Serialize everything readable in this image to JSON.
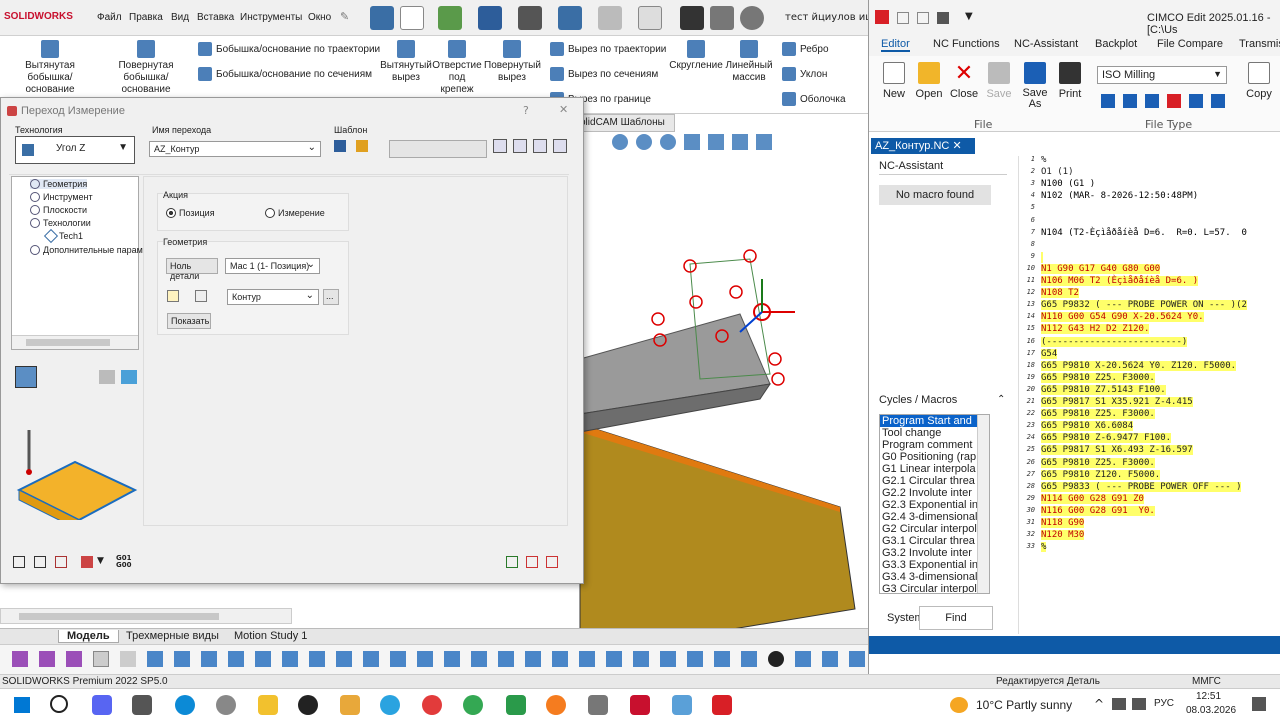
{
  "solidworks": {
    "logo": "SOLIDWORKS",
    "menu": [
      "Файл",
      "Правка",
      "Вид",
      "Вставка",
      "Инструменты",
      "Окно"
    ],
    "doc_title": "тест йциулов ищме",
    "ribbon": {
      "extruded_boss": "Вытянутая бобышка/основание",
      "revolved_boss": "Повернутая бобышка/основание",
      "swept_boss": "Бобышка/основание по траектории",
      "lofted_boss": "Бобышка/основание по сечениям",
      "extruded_cut": "Вытянутый вырез",
      "hole_wizard": "Отверстие под крепеж",
      "revolved_cut": "Повернутый вырез",
      "swept_cut": "Вырез по траектории",
      "lofted_cut": "Вырез по сечениям",
      "boundary_cut": "Вырез по границе",
      "fillet": "Скругление",
      "linear_pattern": "Линейный массив",
      "rib": "Ребро",
      "draft": "Уклон",
      "shell": "Оболочка"
    },
    "solidcam_tab": "olidCAM Шаблоны",
    "bottom_tabs": [
      "Модель",
      "Трехмерные виды",
      "Motion Study 1"
    ],
    "status_left": "SOLIDWORKS Premium 2022 SP5.0",
    "status_mid": "Редактируется Деталь",
    "status_right": "ММГС"
  },
  "dialog": {
    "title": "Переход Измерение",
    "tech_label": "Технология",
    "tech_value": "Угол Z",
    "name_label": "Имя перехода",
    "name_value": "AZ_Контур",
    "template_label": "Шаблон",
    "tree": [
      "Геометрия",
      "Инструмент",
      "Плоскости",
      "Технологии",
      "Tech1",
      "Дополнительные парам"
    ],
    "action_label": "Акция",
    "radio_position": "Позиция",
    "radio_measure": "Измерение",
    "geometry_label": "Геометрия",
    "part_zero_btn": "Ноль детали",
    "mac_value": "Мас 1 (1- Позиция)",
    "contour_value": "Контур",
    "ellipsis": "...",
    "show_btn": "Показать",
    "help": "?",
    "close": "✕"
  },
  "cimco": {
    "title": "CIMCO Edit 2025.01.16 - [C:\\Us",
    "tabs": [
      "Editor",
      "NC Functions",
      "NC-Assistant",
      "Backplot",
      "File Compare",
      "Transmis"
    ],
    "ribbon": {
      "new": "New",
      "open": "Open",
      "close": "Close",
      "save": "Save",
      "save_as": "Save As",
      "print": "Print",
      "copy": "Copy",
      "file_group": "File",
      "file_type_group": "File Type",
      "file_type_value": "ISO Milling"
    },
    "doc_tab": "AZ_Контур.NC",
    "nc_assistant": "NC-Assistant",
    "no_macro": "No macro found",
    "cycles_title": "Cycles / Macros",
    "cycles": [
      "Program Start and",
      "Tool change",
      "Program comment",
      "G0 Positioning (rap",
      "G1 Linear interpola",
      "G2.1 Circular threa",
      "G2.2 Involute inter",
      "G2.3 Exponential in",
      "G2.4 3-dimensional",
      "G2 Circular interpol",
      "G3.1 Circular threa",
      "G3.2 Involute inter",
      "G3.3 Exponential in",
      "G3.4 3-dimensional",
      "G3 Circular interpol"
    ],
    "system_label": "System",
    "find_btn": "Find",
    "code_lines": [
      {
        "n": "1",
        "t": "%",
        "style": "plain"
      },
      {
        "n": "2",
        "t": "O1 (1)",
        "style": "plain"
      },
      {
        "n": "3",
        "t": "N100 (G1 )",
        "style": "plain"
      },
      {
        "n": "4",
        "t": "N102 (MAR- 8-2026-12:50:48PM)",
        "style": "plain"
      },
      {
        "n": "5",
        "t": "",
        "style": "plain"
      },
      {
        "n": "6",
        "t": "",
        "style": "plain"
      },
      {
        "n": "7",
        "t": "N104 (T2-Èçìåðåíèå D=6.  R=0. L=57.  0",
        "style": "plain"
      },
      {
        "n": "8",
        "t": "",
        "style": "plain"
      },
      {
        "n": "9",
        "t": "",
        "style": "hl"
      },
      {
        "n": "10",
        "t": "N1 G90 G17 G40 G80 G00",
        "style": "hl"
      },
      {
        "n": "11",
        "t": "N106 M06 T2 (Èçìåðåíèå D=6. )",
        "style": "hl"
      },
      {
        "n": "12",
        "t": "N108 T2",
        "style": "hl"
      },
      {
        "n": "13",
        "t": "G65 P9832 ( --- PROBE POWER ON --- )(2",
        "style": "hl"
      },
      {
        "n": "14",
        "t": "N110 G00 G54 G90 X-20.5624 Y0.",
        "style": "hl"
      },
      {
        "n": "15",
        "t": "N112 G43 H2 D2 Z120.",
        "style": "hl"
      },
      {
        "n": "16",
        "t": "(-------------------------)",
        "style": "hl"
      },
      {
        "n": "17",
        "t": "G54",
        "style": "hl"
      },
      {
        "n": "18",
        "t": "G65 P9810 X-20.5624 Y0. Z120. F5000.",
        "style": "hl"
      },
      {
        "n": "19",
        "t": "G65 P9810 Z25. F3000.",
        "style": "hl"
      },
      {
        "n": "20",
        "t": "G65 P9810 Z7.5143 F100.",
        "style": "hl"
      },
      {
        "n": "21",
        "t": "G65 P9817 S1 X35.921 Z-4.415",
        "style": "hl"
      },
      {
        "n": "22",
        "t": "G65 P9810 Z25. F3000.",
        "style": "hl"
      },
      {
        "n": "23",
        "t": "G65 P9810 X6.6084",
        "style": "hl"
      },
      {
        "n": "24",
        "t": "G65 P9810 Z-6.9477 F100.",
        "style": "hl"
      },
      {
        "n": "25",
        "t": "G65 P9817 S1 X6.493 Z-16.597",
        "style": "hl"
      },
      {
        "n": "26",
        "t": "G65 P9810 Z25. F3000.",
        "style": "hl"
      },
      {
        "n": "27",
        "t": "G65 P9810 Z120. F5000.",
        "style": "hl"
      },
      {
        "n": "28",
        "t": "G65 P9833 ( --- PROBE POWER OFF --- )",
        "style": "hl"
      },
      {
        "n": "29",
        "t": "N114 G00 G28 G91 Z0",
        "style": "hl"
      },
      {
        "n": "30",
        "t": "N116 G00 G28 G91  Y0.",
        "style": "hl"
      },
      {
        "n": "31",
        "t": "N118 G90",
        "style": "hl"
      },
      {
        "n": "32",
        "t": "N120 M30",
        "style": "hl"
      },
      {
        "n": "33",
        "t": "%",
        "style": "hl"
      }
    ]
  },
  "taskbar": {
    "weather": "10°C  Partly sunny",
    "lang": "РУС",
    "time": "12:51",
    "date": "08.03.2026"
  }
}
